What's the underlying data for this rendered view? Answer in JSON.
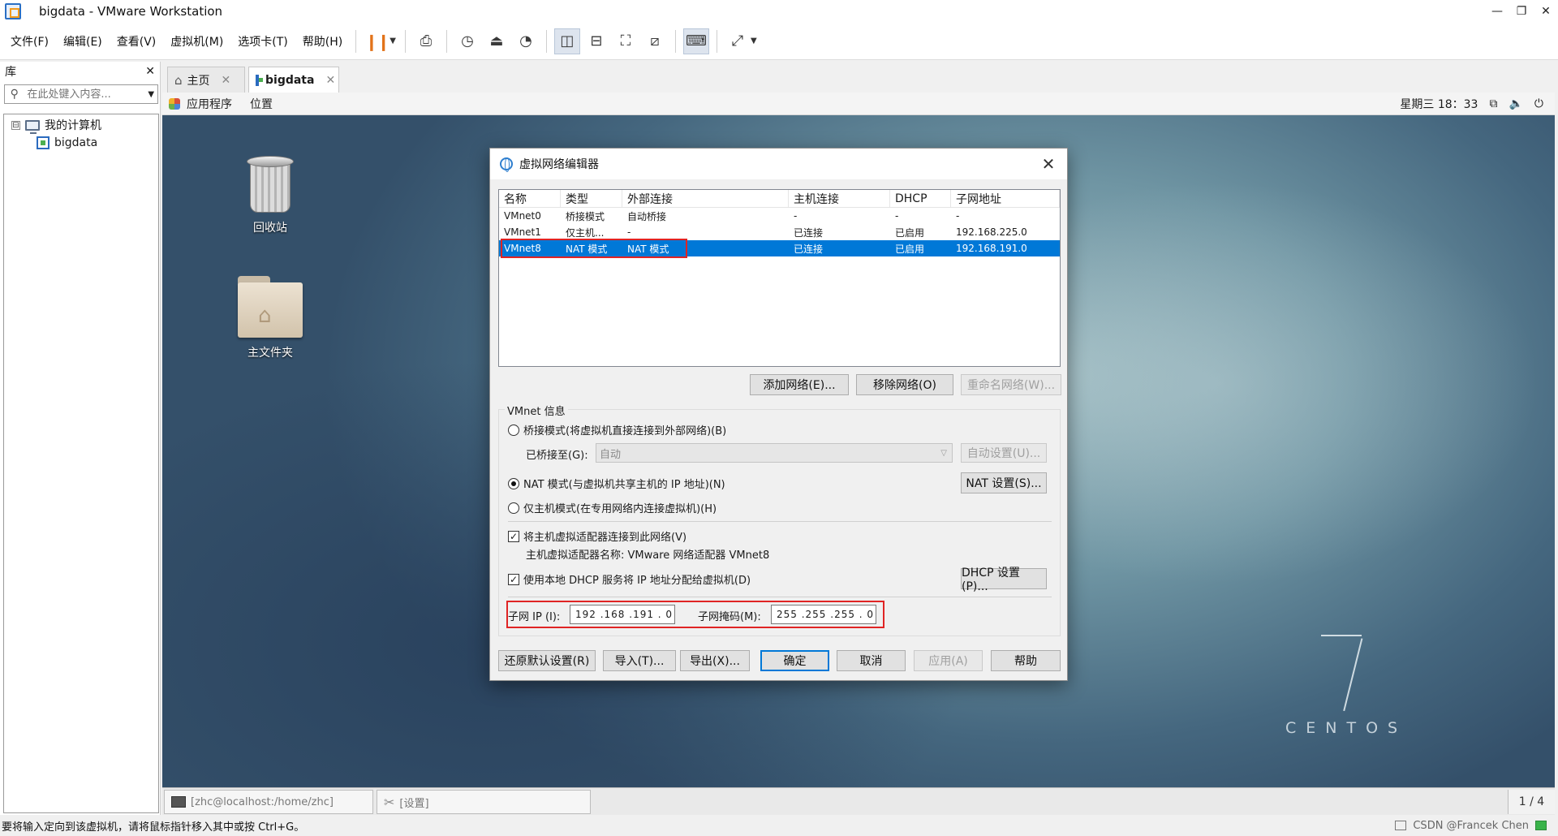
{
  "window": {
    "title": "bigdata - VMware Workstation",
    "controls": [
      "—",
      "❐",
      "✕"
    ]
  },
  "menu": [
    "文件(F)",
    "编辑(E)",
    "查看(V)",
    "虚拟机(M)",
    "选项卡(T)",
    "帮助(H)"
  ],
  "library": {
    "title": "库",
    "close": "✕",
    "search_placeholder": "在此处键入内容...",
    "tree_root": "我的计算机",
    "tree_toggle": "⊟",
    "tree_child": "bigdata"
  },
  "tabs": [
    {
      "label": "主页",
      "active": false
    },
    {
      "label": "bigdata",
      "active": true
    }
  ],
  "guest_topbar": {
    "apps": "应用程序",
    "places": "位置",
    "clock": "星期三 18：33"
  },
  "desktop": {
    "trash_label": "回收站",
    "home_label": "主文件夹",
    "brand": "CENTOS"
  },
  "guest_taskbar": {
    "terminal": "[zhc@localhost:/home/zhc]",
    "settings": "[设置]",
    "pages": "1 / 4"
  },
  "statusbar": {
    "message": "要将输入定向到该虚拟机，请将鼠标指针移入其中或按 Ctrl+G。",
    "watermark": "CSDN @Francek Chen"
  },
  "dialog": {
    "title": "虚拟网络编辑器",
    "close": "✕",
    "table": {
      "columns": [
        "名称",
        "类型",
        "外部连接",
        "主机连接",
        "DHCP",
        "子网地址"
      ],
      "rows": [
        [
          "VMnet0",
          "桥接模式",
          "自动桥接",
          "-",
          "-",
          "-"
        ],
        [
          "VMnet1",
          "仅主机...",
          "-",
          "已连接",
          "已启用",
          "192.168.225.0"
        ],
        [
          "VMnet8",
          "NAT 模式",
          "NAT 模式",
          "已连接",
          "已启用",
          "192.168.191.0"
        ]
      ],
      "selected_row": 2
    },
    "table_buttons": {
      "add": "添加网络(E)...",
      "remove": "移除网络(O)",
      "rename": "重命名网络(W)..."
    },
    "vmnet_info": {
      "group_label": "VMnet 信息",
      "bridged_option": "桥接模式(将虚拟机直接连接到外部网络)(B)",
      "bridged_to_label": "已桥接至(G):",
      "bridged_to_value": "自动",
      "auto_settings": "自动设置(U)...",
      "nat_option": "NAT 模式(与虚拟机共享主机的 IP 地址)(N)",
      "nat_settings": "NAT 设置(S)...",
      "hostonly_option": "仅主机模式(在专用网络内连接虚拟机)(H)",
      "connect_adapter": "将主机虚拟适配器连接到此网络(V)",
      "adapter_name": "主机虚拟适配器名称: VMware 网络适配器 VMnet8",
      "use_dhcp": "使用本地 DHCP 服务将 IP 地址分配给虚拟机(D)",
      "dhcp_settings": "DHCP 设置(P)...",
      "subnet_ip_label": "子网 IP (I):",
      "subnet_ip_value": "192 .168 .191 .  0",
      "subnet_mask_label": "子网掩码(M):",
      "subnet_mask_value": "255 .255 .255 .  0",
      "selected_mode": "nat",
      "connect_adapter_checked": true,
      "use_dhcp_checked": true
    },
    "footer_buttons": {
      "restore": "还原默认设置(R)",
      "import": "导入(T)...",
      "export": "导出(X)...",
      "ok": "确定",
      "cancel": "取消",
      "apply": "应用(A)",
      "help": "帮助"
    }
  },
  "colors": {
    "selection": "#0078d7",
    "highlight_box": "#e02424",
    "pause_icon": "#e2731a"
  }
}
